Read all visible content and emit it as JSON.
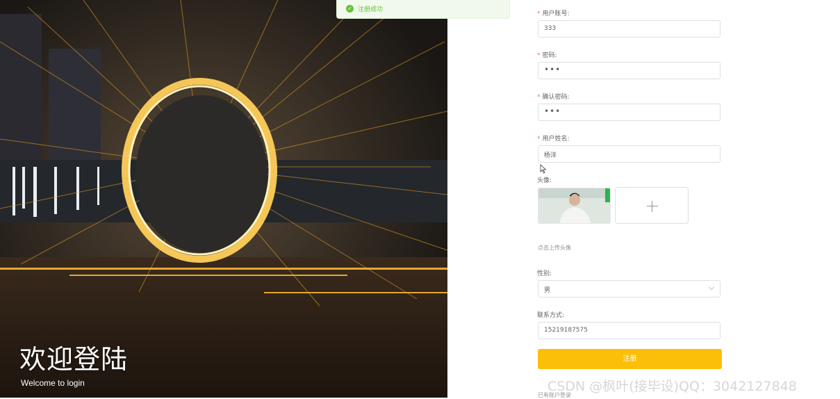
{
  "hero": {
    "title": "欢迎登陆",
    "subtitle": "Welcome to login"
  },
  "toast": {
    "icon": "check-circle-icon",
    "message": "注册成功"
  },
  "form": {
    "account_label": "用户账号:",
    "account_value": "333",
    "password_label": "密码:",
    "password_value": "•••",
    "confirm_label": "确认密码:",
    "confirm_value": "•••",
    "name_label": "用户姓名:",
    "name_value": "杨洋",
    "avatar_label": "头像:",
    "upload_hint": "点击上传头像",
    "gender_label": "性别:",
    "gender_value": "男",
    "contact_label": "联系方式:",
    "contact_value": "15219187575",
    "submit_label": "注册",
    "login_link": "已有账户登录"
  },
  "watermark": "CSDN @枫叶(接毕设)QQ：3042127848",
  "colors": {
    "accent": "#fbbf09",
    "success": "#67c23a",
    "required": "#f56c6c"
  }
}
